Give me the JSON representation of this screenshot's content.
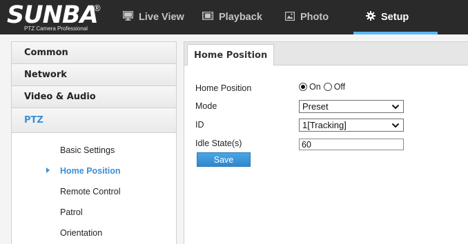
{
  "brand": {
    "name": "SUNBA",
    "registered": "®",
    "tagline": "PTZ Camera Professional"
  },
  "nav": {
    "live_view": "Live View",
    "playback": "Playback",
    "photo": "Photo",
    "setup": "Setup",
    "active": "setup",
    "accent_color": "#5ab7ff"
  },
  "sidebar": {
    "sections": [
      "Common",
      "Network",
      "Video & Audio",
      "PTZ"
    ],
    "active_section": "PTZ",
    "items": [
      "Basic Settings",
      "Home Position",
      "Remote Control",
      "Patrol",
      "Orientation"
    ],
    "active_item": "Home Position",
    "active_color": "#3a8fd6"
  },
  "panel": {
    "tab": "Home Position",
    "fields": {
      "home_position_label": "Home Position",
      "on_label": "On",
      "off_label": "Off",
      "home_position_value": "On",
      "mode_label": "Mode",
      "mode_value": "Preset",
      "id_label": "ID",
      "id_value": "1[Tracking]",
      "idle_label": "Idle State(s)",
      "idle_value": "60"
    },
    "save_label": "Save"
  }
}
